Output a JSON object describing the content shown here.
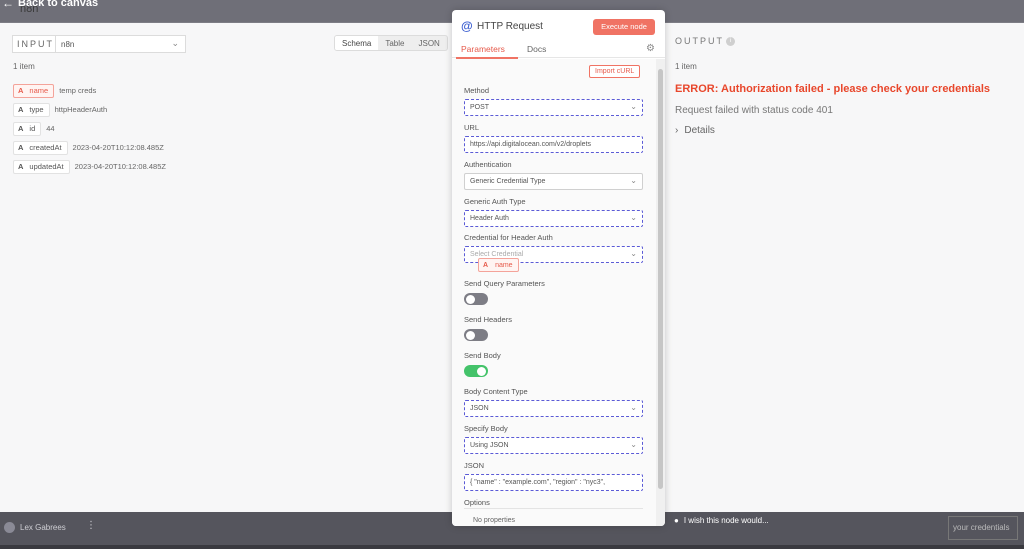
{
  "app": {
    "logo_text": "n8n",
    "back_label": "Back to canvas",
    "user_name": "Lex Gabrees",
    "wish_label": "I wish this node would...",
    "bg_creds_text": "your credentials"
  },
  "input_panel": {
    "label": "INPUT",
    "source": "n8n",
    "view_tabs": [
      "Schema",
      "Table",
      "JSON"
    ],
    "active_view": "Schema",
    "items_count": "1 item",
    "fields": [
      {
        "type": "A",
        "name": "name",
        "value": "temp creds",
        "highlighted": true
      },
      {
        "type": "A",
        "name": "type",
        "value": "httpHeaderAuth"
      },
      {
        "type": "A",
        "name": "id",
        "value": "44"
      },
      {
        "type": "A",
        "name": "createdAt",
        "value": "2023-04-20T10:12:08.485Z"
      },
      {
        "type": "A",
        "name": "updatedAt",
        "value": "2023-04-20T10:12:08.485Z"
      }
    ]
  },
  "node": {
    "icon": "@",
    "title": "HTTP Request",
    "execute_label": "Execute node",
    "tabs": [
      "Parameters",
      "Docs"
    ],
    "active_tab": "Parameters",
    "import_curl_label": "Import cURL",
    "fields": {
      "method": {
        "label": "Method",
        "value": "POST"
      },
      "url": {
        "label": "URL",
        "value": "https://api.digitalocean.com/v2/droplets"
      },
      "authentication": {
        "label": "Authentication",
        "value": "Generic Credential Type"
      },
      "generic_auth_type": {
        "label": "Generic Auth Type",
        "value": "Header Auth"
      },
      "credential": {
        "label": "Credential for Header Auth",
        "placeholder": "Select Credential"
      },
      "send_query": {
        "label": "Send Query Parameters",
        "on": false
      },
      "send_headers": {
        "label": "Send Headers",
        "on": false
      },
      "send_body": {
        "label": "Send Body",
        "on": true
      },
      "body_content_type": {
        "label": "Body Content Type",
        "value": "JSON"
      },
      "specify_body": {
        "label": "Specify Body",
        "value": "Using JSON"
      },
      "json": {
        "label": "JSON",
        "value": "{  \"name\" : \"example.com\",   \"region\" : \"nyc3\","
      }
    },
    "drag_pill": {
      "type": "A",
      "name": "name"
    },
    "options_label": "Options",
    "no_properties": "No properties"
  },
  "output_panel": {
    "label": "OUTPUT",
    "items_count": "1 item",
    "error_title": "ERROR: Authorization failed - please check your credentials",
    "error_status": "Request failed with status code 401",
    "details_label": "Details"
  },
  "colors": {
    "accent": "#f07364",
    "error": "#e8472c",
    "toggle_on": "#44c36a",
    "focus_border": "#5b5bd6"
  },
  "icons": [
    "back-arrow-icon",
    "info-icon",
    "gear-icon",
    "chevron-down-icon",
    "chevron-right-icon",
    "lightbulb-icon",
    "kebab-icon"
  ]
}
